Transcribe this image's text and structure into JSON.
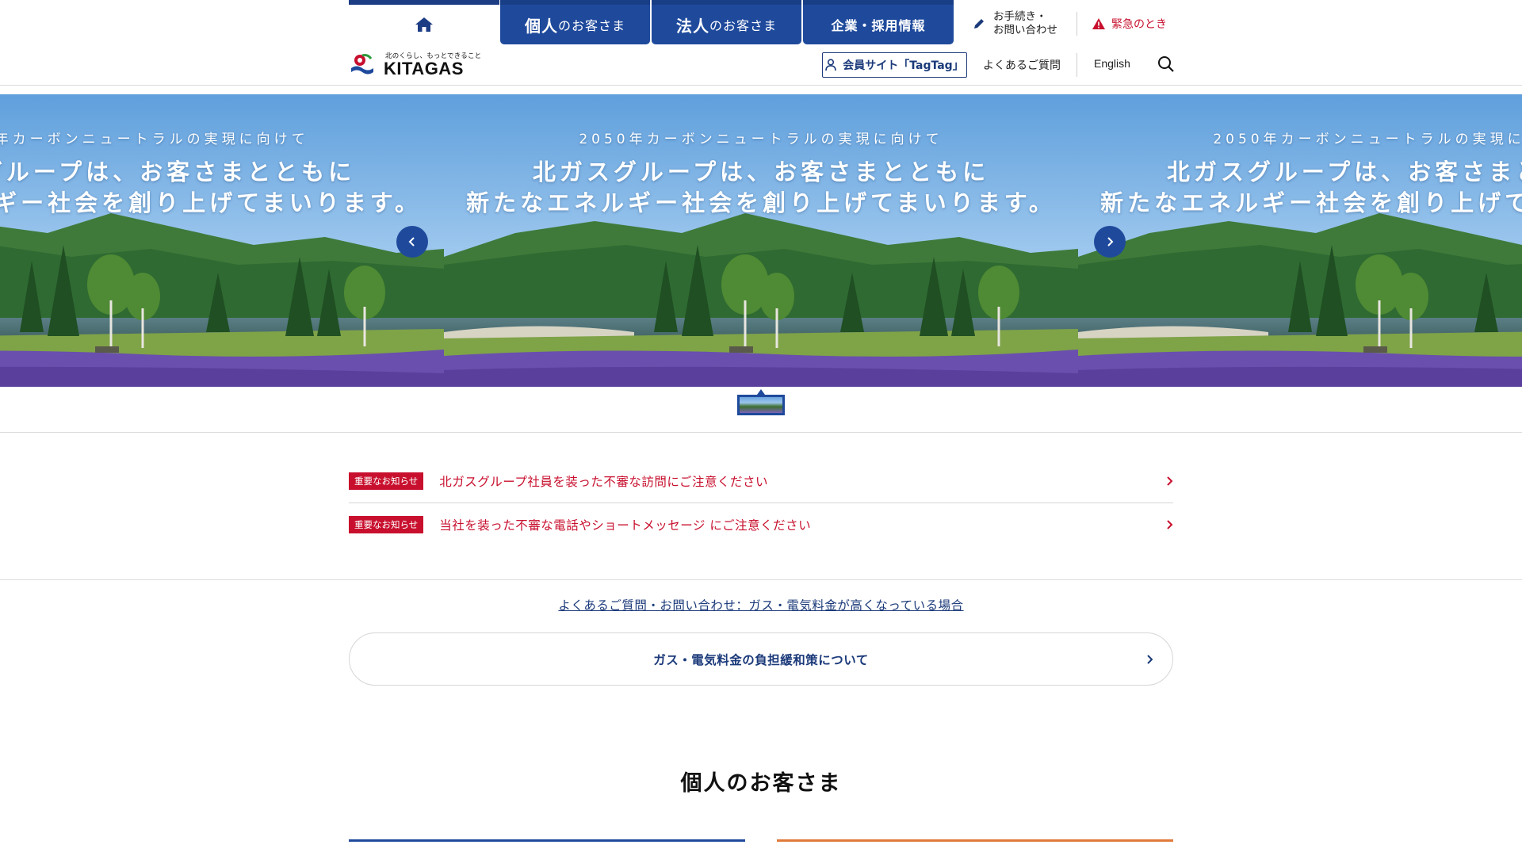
{
  "header": {
    "nav_tabs": {
      "personal_main": "個人",
      "personal_rest": "のお客さま",
      "corporate_main": "法人",
      "corporate_rest": "のお客さま",
      "company": "企業・採用情報"
    },
    "procedures_line1": "お手続き・",
    "procedures_line2": "お問い合わせ",
    "emergency": "緊急のとき",
    "logo_tagline": "北のくらし、もっとできること",
    "logo_word": "KITAGAS",
    "member_site": "会員サイト「TagTag」",
    "faq": "よくあるご質問",
    "english": "English"
  },
  "hero": {
    "subtitle": "2050年カーボンニュートラルの実現に向けて",
    "title_line1": "北ガスグループは、お客さまとともに",
    "title_line2": "新たなエネルギー社会を創り上げてまいります。"
  },
  "notices": [
    {
      "badge": "重要なお知らせ",
      "text": "北ガスグループ社員を装った不審な訪問にご注意ください"
    },
    {
      "badge": "重要なお知らせ",
      "text": "当社を装った不審な電話やショートメッセージ にご注意ください"
    }
  ],
  "faq_banner_link": "よくあるご質問・お問い合わせ：ガス・電気料金が高くなっている場合",
  "relief_button": "ガス・電気料金の負担緩和策について",
  "personal_heading": "個人のお客さま",
  "colors": {
    "brand_navy": "#1f4a9c",
    "alert_red": "#c8102e",
    "accent_orange": "#e07a3a"
  },
  "icons": [
    "home-icon",
    "pencil-icon",
    "warning-icon",
    "user-icon",
    "search-icon",
    "chevron-left-icon",
    "chevron-right-icon"
  ]
}
